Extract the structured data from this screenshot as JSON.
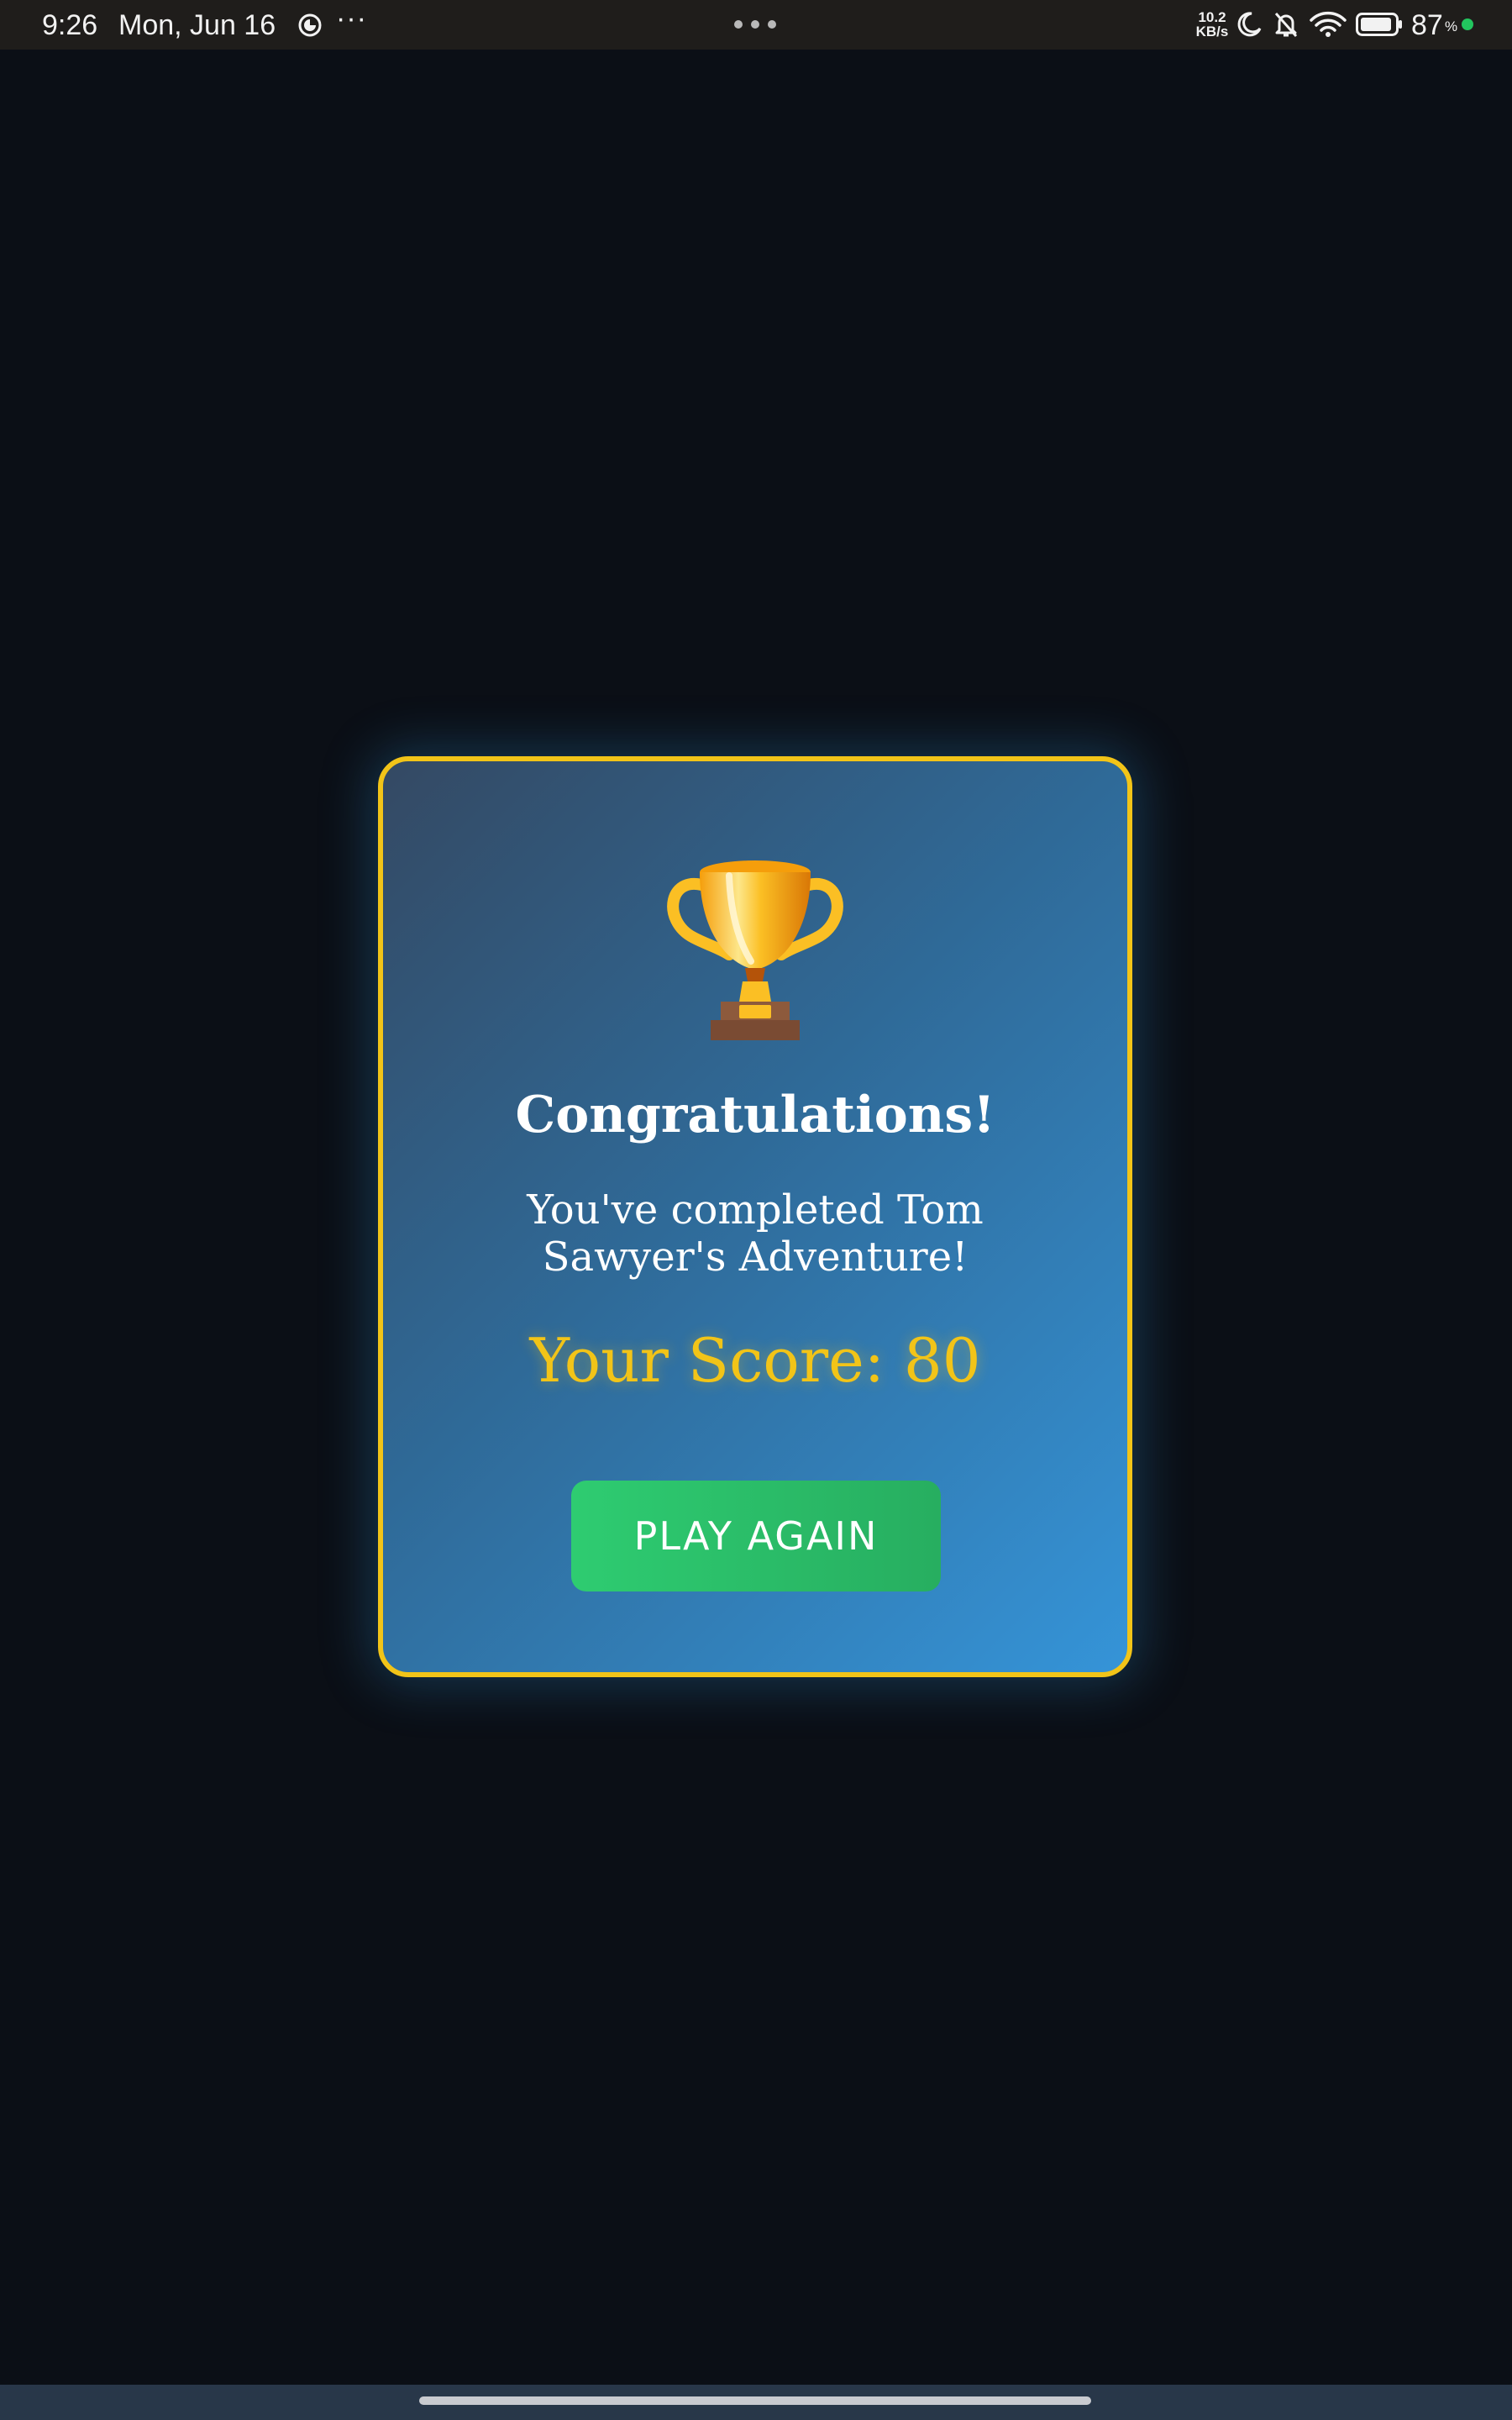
{
  "status_bar": {
    "time": "9:26",
    "date": "Mon, Jun 16",
    "more": "···",
    "net_speed_value": "10.2",
    "net_speed_unit": "KB/s",
    "battery_percent": "87",
    "battery_percent_sign": "%",
    "icons": [
      "app-notification-icon",
      "more-icon",
      "moon-icon",
      "bell-off-icon",
      "wifi-icon",
      "battery-icon",
      "charging-dot-icon"
    ]
  },
  "result_card": {
    "icon": "trophy-icon",
    "title": "Congratulations!",
    "message": "You've completed Tom Sawyer's Adventure!",
    "score_label": "Your Score: ",
    "score_value": "80",
    "play_again_label": "PLAY AGAIN"
  },
  "colors": {
    "background": "#0b0f16",
    "card_border": "#f2c418",
    "score_text": "#f2c418",
    "button_green": "#2ecc71",
    "card_gradient_start": "#344963",
    "card_gradient_end": "#3594d8",
    "status_bar": "#1f1d1b",
    "nav_bar": "#283749"
  }
}
